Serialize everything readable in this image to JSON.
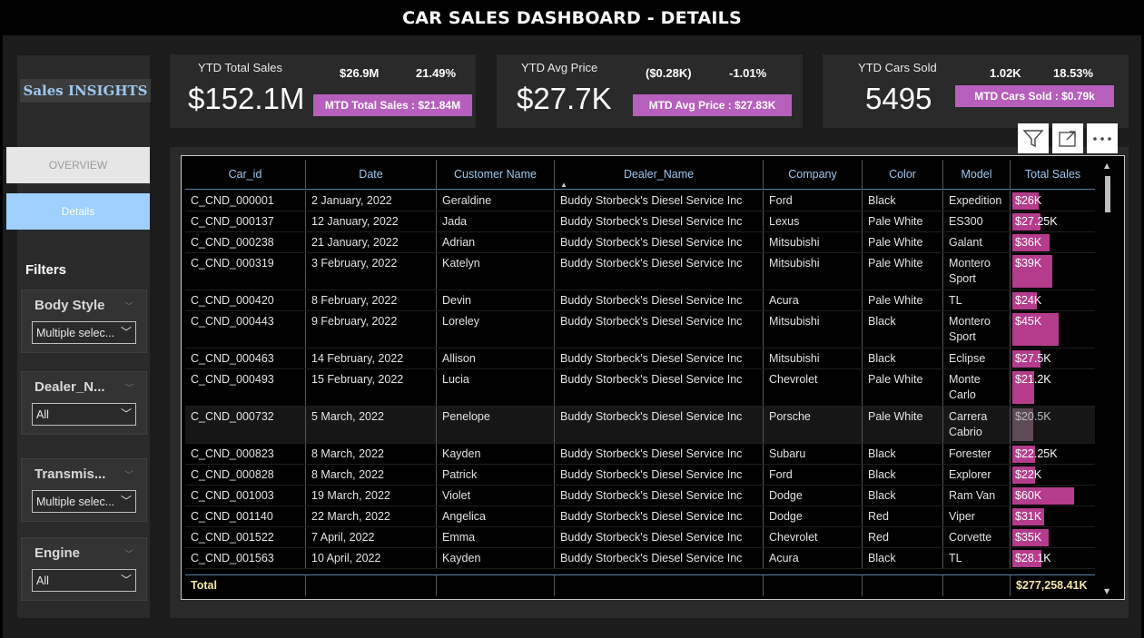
{
  "title": "CAR SALES DASHBOARD - DETAILS",
  "logo_text": "Sales INSIGHTS",
  "nav": {
    "overview": "OVERVIEW",
    "details": "Details"
  },
  "filters_title": "Filters",
  "slicers": [
    {
      "label": "Body Style",
      "value": "Multiple selec..."
    },
    {
      "label": "Dealer_N...",
      "value": "All"
    },
    {
      "label": "Transmis...",
      "value": "Multiple selec..."
    },
    {
      "label": "Engine",
      "value": "All"
    }
  ],
  "kpis": [
    {
      "label": "YTD Total Sales",
      "value": "$152.1M",
      "delta_value": "$26.9M",
      "delta_pct": "21.49%",
      "badge": "MTD Total Sales : $21.84M"
    },
    {
      "label": "YTD Avg Price",
      "value": "$27.7K",
      "delta_value": "($0.28K)",
      "delta_pct": "-1.01%",
      "badge": "MTD Avg Price : $27.83K"
    },
    {
      "label": "YTD Cars Sold",
      "value": "5495",
      "delta_value": "1.02K",
      "delta_pct": "18.53%",
      "badge": "MTD Cars Sold : $0.79k"
    }
  ],
  "table": {
    "columns": [
      "Car_id",
      "Date",
      "Customer Name",
      "Dealer_Name",
      "Company",
      "Color",
      "Model",
      "Total Sales"
    ],
    "rows": [
      {
        "car_id": "C_CND_000001",
        "date": "2 January, 2022",
        "customer": "Geraldine",
        "dealer": "Buddy Storbeck's Diesel Service Inc",
        "company": "Ford",
        "color": "Black",
        "model": "Expedition",
        "sales": "$26K",
        "sales_value": 26000
      },
      {
        "car_id": "C_CND_000137",
        "date": "12 January, 2022",
        "customer": "Jada",
        "dealer": "Buddy Storbeck's Diesel Service Inc",
        "company": "Lexus",
        "color": "Pale White",
        "model": "ES300",
        "sales": "$27.25K",
        "sales_value": 27250
      },
      {
        "car_id": "C_CND_000238",
        "date": "21 January, 2022",
        "customer": "Adrian",
        "dealer": "Buddy Storbeck's Diesel Service Inc",
        "company": "Mitsubishi",
        "color": "Pale White",
        "model": "Galant",
        "sales": "$36K",
        "sales_value": 36000
      },
      {
        "car_id": "C_CND_000319",
        "date": "3 February, 2022",
        "customer": "Katelyn",
        "dealer": "Buddy Storbeck's Diesel Service Inc",
        "company": "Mitsubishi",
        "color": "Pale White",
        "model": "Montero Sport",
        "sales": "$39K",
        "sales_value": 39000
      },
      {
        "car_id": "C_CND_000420",
        "date": "8 February, 2022",
        "customer": "Devin",
        "dealer": "Buddy Storbeck's Diesel Service Inc",
        "company": "Acura",
        "color": "Pale White",
        "model": "TL",
        "sales": "$24K",
        "sales_value": 24000
      },
      {
        "car_id": "C_CND_000443",
        "date": "9 February, 2022",
        "customer": "Loreley",
        "dealer": "Buddy Storbeck's Diesel Service Inc",
        "company": "Mitsubishi",
        "color": "Black",
        "model": "Montero Sport",
        "sales": "$45K",
        "sales_value": 45000
      },
      {
        "car_id": "C_CND_000463",
        "date": "14 February, 2022",
        "customer": "Allison",
        "dealer": "Buddy Storbeck's Diesel Service Inc",
        "company": "Mitsubishi",
        "color": "Black",
        "model": "Eclipse",
        "sales": "$27.5K",
        "sales_value": 27500
      },
      {
        "car_id": "C_CND_000493",
        "date": "15 February, 2022",
        "customer": "Lucia",
        "dealer": "Buddy Storbeck's Diesel Service Inc",
        "company": "Chevrolet",
        "color": "Pale White",
        "model": "Monte Carlo",
        "sales": "$21.2K",
        "sales_value": 21200
      },
      {
        "car_id": "C_CND_000732",
        "date": "5 March, 2022",
        "customer": "Penelope",
        "dealer": "Buddy Storbeck's Diesel Service Inc",
        "company": "Porsche",
        "color": "Pale White",
        "model": "Carrera Cabrio",
        "sales": "$20.5K",
        "sales_value": 20500,
        "dim": true
      },
      {
        "car_id": "C_CND_000823",
        "date": "8 March, 2022",
        "customer": "Kayden",
        "dealer": "Buddy Storbeck's Diesel Service Inc",
        "company": "Subaru",
        "color": "Black",
        "model": "Forester",
        "sales": "$22.25K",
        "sales_value": 22250
      },
      {
        "car_id": "C_CND_000828",
        "date": "8 March, 2022",
        "customer": "Patrick",
        "dealer": "Buddy Storbeck's Diesel Service Inc",
        "company": "Ford",
        "color": "Black",
        "model": "Explorer",
        "sales": "$22K",
        "sales_value": 22000
      },
      {
        "car_id": "C_CND_001003",
        "date": "19 March, 2022",
        "customer": "Violet",
        "dealer": "Buddy Storbeck's Diesel Service Inc",
        "company": "Dodge",
        "color": "Black",
        "model": "Ram Van",
        "sales": "$60K",
        "sales_value": 60000
      },
      {
        "car_id": "C_CND_001140",
        "date": "22 March, 2022",
        "customer": "Angelica",
        "dealer": "Buddy Storbeck's Diesel Service Inc",
        "company": "Dodge",
        "color": "Red",
        "model": "Viper",
        "sales": "$31K",
        "sales_value": 31000
      },
      {
        "car_id": "C_CND_001522",
        "date": "7 April, 2022",
        "customer": "Emma",
        "dealer": "Buddy Storbeck's Diesel Service Inc",
        "company": "Chevrolet",
        "color": "Red",
        "model": "Corvette",
        "sales": "$35K",
        "sales_value": 35000
      },
      {
        "car_id": "C_CND_001563",
        "date": "10 April, 2022",
        "customer": "Kayden",
        "dealer": "Buddy Storbeck's Diesel Service Inc",
        "company": "Acura",
        "color": "Black",
        "model": "TL",
        "sales": "$28.1K",
        "sales_value": 28100
      }
    ],
    "total_label": "Total",
    "total_value": "$277,258.41K"
  },
  "icons": {
    "filter": "filter-icon",
    "focus": "focus-mode-icon",
    "more": "more-options-icon"
  },
  "colors": {
    "accent": "#b65fbd",
    "bar": "#b53c8c",
    "header_text": "#9ec8f0",
    "details_nav": "#9fd0ff",
    "total_text": "#f5e6a8"
  }
}
